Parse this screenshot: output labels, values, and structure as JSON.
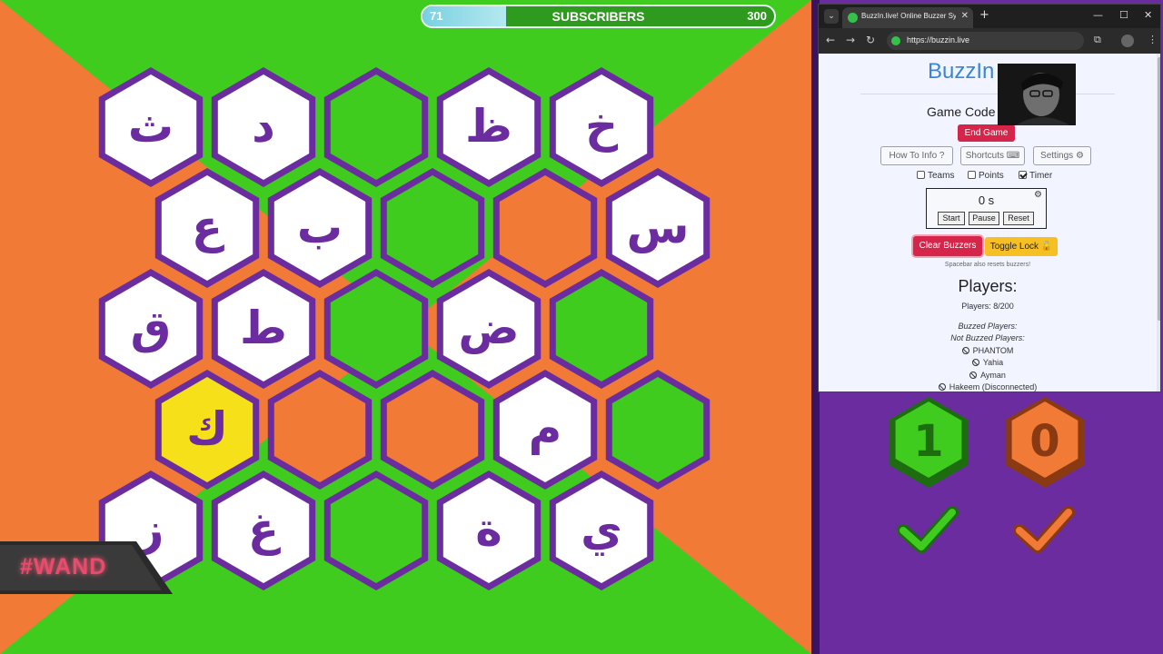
{
  "subscriber_bar": {
    "current": "71",
    "label": "SUBSCRIBERS",
    "goal": "300",
    "progress": 0.237
  },
  "board": {
    "colors": {
      "purple": "#6a2c9e",
      "green": "#3fcc1f",
      "orange": "#f07a36",
      "white": "#ffffff",
      "yellow": "#f5e01a"
    },
    "cells": [
      {
        "row": 0,
        "col": 0,
        "letter": "ث",
        "fill": "white"
      },
      {
        "row": 0,
        "col": 1,
        "letter": "د",
        "fill": "white"
      },
      {
        "row": 0,
        "col": 2,
        "letter": "",
        "fill": "green"
      },
      {
        "row": 0,
        "col": 3,
        "letter": "ظ",
        "fill": "white"
      },
      {
        "row": 0,
        "col": 4,
        "letter": "خ",
        "fill": "white"
      },
      {
        "row": 1,
        "col": 0,
        "letter": "ع",
        "fill": "white"
      },
      {
        "row": 1,
        "col": 1,
        "letter": "ب",
        "fill": "white"
      },
      {
        "row": 1,
        "col": 2,
        "letter": "",
        "fill": "green"
      },
      {
        "row": 1,
        "col": 3,
        "letter": "",
        "fill": "orange"
      },
      {
        "row": 1,
        "col": 4,
        "letter": "س",
        "fill": "white"
      },
      {
        "row": 2,
        "col": 0,
        "letter": "ق",
        "fill": "white"
      },
      {
        "row": 2,
        "col": 1,
        "letter": "ط",
        "fill": "white"
      },
      {
        "row": 2,
        "col": 2,
        "letter": "",
        "fill": "green"
      },
      {
        "row": 2,
        "col": 3,
        "letter": "ض",
        "fill": "white"
      },
      {
        "row": 2,
        "col": 4,
        "letter": "",
        "fill": "green"
      },
      {
        "row": 3,
        "col": 0,
        "letter": "ك",
        "fill": "yellow"
      },
      {
        "row": 3,
        "col": 1,
        "letter": "",
        "fill": "orange"
      },
      {
        "row": 3,
        "col": 2,
        "letter": "",
        "fill": "orange"
      },
      {
        "row": 3,
        "col": 3,
        "letter": "م",
        "fill": "white"
      },
      {
        "row": 3,
        "col": 4,
        "letter": "",
        "fill": "green"
      },
      {
        "row": 4,
        "col": 0,
        "letter": "ز",
        "fill": "white"
      },
      {
        "row": 4,
        "col": 1,
        "letter": "غ",
        "fill": "white"
      },
      {
        "row": 4,
        "col": 2,
        "letter": "",
        "fill": "green"
      },
      {
        "row": 4,
        "col": 3,
        "letter": "ة",
        "fill": "white"
      },
      {
        "row": 4,
        "col": 4,
        "letter": "ي",
        "fill": "white"
      }
    ]
  },
  "watermark": "#WAND",
  "browser": {
    "tab_title": "BuzzIn.live! Online Buzzer System",
    "url": "https://buzzin.live",
    "page": {
      "logo": "BuzzIn",
      "game_code_label": "Game Code",
      "end_game": "End Game",
      "how_to": "How To Info",
      "shortcuts": "Shortcuts",
      "settings": "Settings",
      "checkboxes": [
        {
          "label": "Teams",
          "checked": false
        },
        {
          "label": "Points",
          "checked": false
        },
        {
          "label": "Timer",
          "checked": true
        }
      ],
      "timer_value": "0 s",
      "timer_start": "Start",
      "timer_pause": "Pause",
      "timer_reset": "Reset",
      "clear_buzzers": "Clear Buzzers",
      "toggle_lock": "Toggle Lock",
      "spacebar_hint": "Spacebar also resets buzzers!",
      "players_title": "Players:",
      "players_count": "Players: 8/200",
      "buzzed_label": "Buzzed Players:",
      "not_buzzed_label": "Not Buzzed Players:",
      "not_buzzed": [
        "PHANTOM",
        "Yahia",
        "Ayman",
        "Hakeem (Disconnected)"
      ]
    }
  },
  "scores": [
    {
      "team": "green",
      "score": "1",
      "color": "#3fcc1f",
      "dark": "#1d6d10"
    },
    {
      "team": "orange",
      "score": "0",
      "color": "#f07a36",
      "dark": "#8a3a12"
    }
  ]
}
